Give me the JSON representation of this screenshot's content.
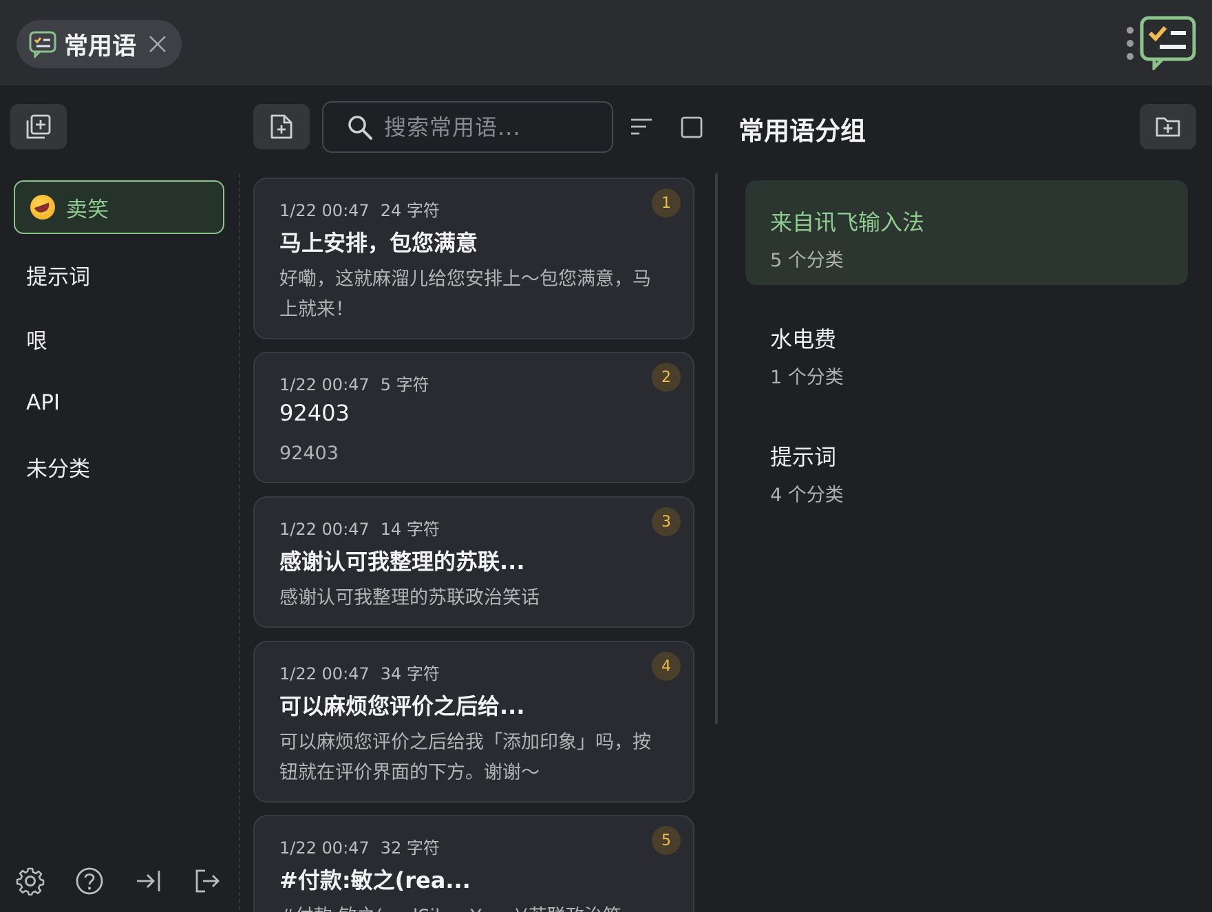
{
  "titlebar": {
    "tab_label": "常用语",
    "colors": {
      "accent_green": "#8bc48b",
      "accent_yellow": "#f0bd52"
    }
  },
  "toolbar": {
    "search_placeholder": "搜索常用语..."
  },
  "sidebar": {
    "categories": [
      {
        "label": "卖笑",
        "emoji": "rolling-on-floor-laughing",
        "active": true
      },
      {
        "label": "提示词"
      },
      {
        "label": "哏"
      },
      {
        "label": "API"
      },
      {
        "label": "未分类"
      }
    ]
  },
  "phrases": [
    {
      "time": "1/22 00:47",
      "chars": "24 字符",
      "title": "马上安排，包您满意",
      "body": "好嘞，这就麻溜儿给您安排上～包您满意，马上就来！",
      "index": "1"
    },
    {
      "time": "1/22 00:47",
      "chars": "5 字符",
      "title": "92403",
      "body": "92403",
      "index": "2"
    },
    {
      "time": "1/22 00:47",
      "chars": "14 字符",
      "title": "感谢认可我整理的苏联...",
      "body": "感谢认可我整理的苏联政治笑话",
      "index": "3"
    },
    {
      "time": "1/22 00:47",
      "chars": "34 字符",
      "title": "可以麻烦您评价之后给...",
      "body": "可以麻烦您评价之后给我「添加印象」吗，按钮就在评价界面的下方。谢谢～",
      "index": "4"
    },
    {
      "time": "1/22 00:47",
      "chars": "32 字符",
      "title": "#付款:敏之(rea...",
      "body": "#付款:敏之(realSilverYang)(苏联政治笑",
      "index": "5"
    }
  ],
  "groups_panel": {
    "title": "常用语分组",
    "groups": [
      {
        "name": "来自讯飞输入法",
        "count": "5 个分类",
        "active": true
      },
      {
        "name": "水电费",
        "count": "1 个分类"
      },
      {
        "name": "提示词",
        "count": "4 个分类"
      }
    ]
  }
}
